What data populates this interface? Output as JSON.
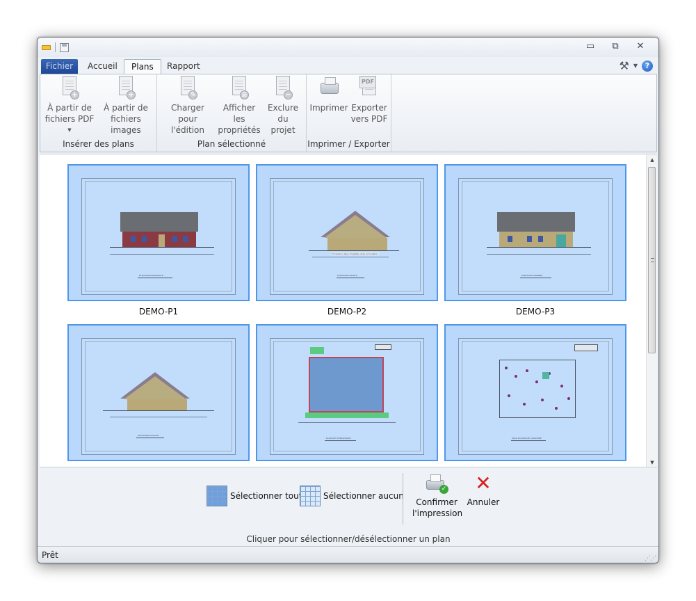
{
  "window": {
    "controls": {
      "minimize": "▭",
      "restore": "⧉",
      "close": "✕"
    }
  },
  "tabs": [
    {
      "label": "Fichier"
    },
    {
      "label": "Accueil"
    },
    {
      "label": "Plans",
      "active": true
    },
    {
      "label": "Rapport"
    }
  ],
  "ribbon": {
    "groups": [
      {
        "label": "Insérer des plans",
        "buttons": [
          {
            "line1": "À partir de",
            "line2": "fichiers PDF",
            "has_dropdown": true,
            "icon": "pdf-add-icon"
          },
          {
            "line1": "À partir de",
            "line2": "fichiers images",
            "icon": "image-add-icon"
          }
        ]
      },
      {
        "label": "Plan sélectionné",
        "buttons": [
          {
            "line1": "Charger pour",
            "line2": "l'édition",
            "icon": "edit-document-icon"
          },
          {
            "line1": "Afficher les",
            "line2": "propriétés",
            "icon": "properties-icon"
          },
          {
            "line1": "Exclure du",
            "line2": "projet",
            "icon": "exclude-icon"
          }
        ]
      },
      {
        "label": "Imprimer / Exporter",
        "buttons": [
          {
            "line1": "Imprimer",
            "line2": "",
            "icon": "printer-icon"
          },
          {
            "line1": "Exporter",
            "line2": "vers PDF",
            "icon": "pdf-export-icon"
          }
        ]
      }
    ]
  },
  "plans": [
    {
      "name": "DEMO-P1",
      "caption": "ÉLÉVATION PRINCIPALE"
    },
    {
      "name": "DEMO-P2",
      "caption": "ÉLÉVATION DROITE",
      "note": "Fondation déjà complétée dans la fondation"
    },
    {
      "name": "DEMO-P3",
      "caption": "ÉLÉVATION ARRIÈRE"
    },
    {
      "name": "",
      "caption": "ÉLÉVATION GAUCHE"
    },
    {
      "name": "",
      "caption": "PLAN DES FONDATIONS"
    },
    {
      "name": "",
      "caption": "PLAN DU REZ-DE-CHAUSSÉE"
    }
  ],
  "bottom": {
    "select_all": "Sélectionner tout",
    "select_none": "Sélectionner aucun",
    "confirm_line1": "Confirmer",
    "confirm_line2": "l'impression",
    "cancel": "Annuler",
    "hint": "Cliquer pour sélectionner/désélectionner un plan"
  },
  "status": {
    "text": "Prêt"
  },
  "colors": {
    "selection_fill": "#b9d8fb",
    "selection_border": "#4f97e8",
    "file_tab": "#2b56a6",
    "cancel_x": "#d51f1f"
  }
}
